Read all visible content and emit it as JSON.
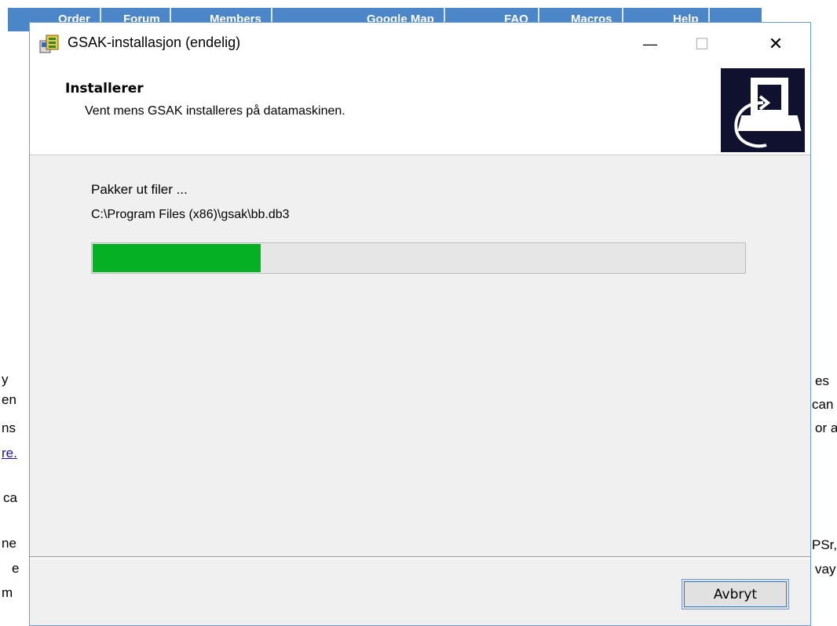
{
  "background_page": {
    "nav_items": [
      "Order",
      "Forum",
      "Members",
      "Google Map",
      "FAQ",
      "Macros",
      "Help"
    ],
    "left_fragments": [
      "y",
      "en",
      "ns",
      "re.",
      "ca",
      "ne",
      "e",
      "m"
    ],
    "right_fragments": [
      "es",
      "can",
      "or a",
      "PSr,",
      "vay"
    ]
  },
  "window": {
    "title": "GSAK-installasjon (endelig)",
    "controls": {
      "minimize": "—",
      "maximize": "☐",
      "close": "✕"
    },
    "header_title": "Installerer",
    "header_subtitle": "Vent mens GSAK installeres på datamaskinen.",
    "status_text": "Pakker ut filer ...",
    "current_file": "C:\\Program Files (x86)\\gsak\\bb.db3",
    "progress_fraction": 0.26,
    "cancel_label": "Avbryt"
  },
  "colors": {
    "progress_fill": "#06b025",
    "nav_bar": "#4a86c8",
    "header_image_bg": "#10112e"
  },
  "icons": [
    "installer-icon",
    "installer-computer-icon"
  ]
}
